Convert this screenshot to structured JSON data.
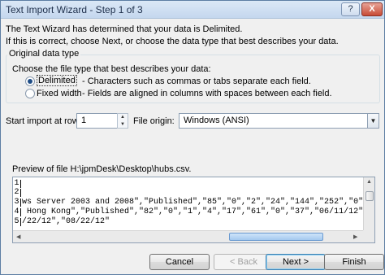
{
  "window": {
    "title": "Text Import Wizard - Step 1 of 3",
    "help_label": "?",
    "close_label": "X"
  },
  "intro": {
    "line1": "The Text Wizard has determined that your data is Delimited.",
    "line2": "If this is correct, choose Next, or choose the data type that best describes your data."
  },
  "original_data_type": {
    "group_label": "Original data type",
    "prompt": "Choose the file type that best describes your data:",
    "options": [
      {
        "label": "Delimited",
        "description": "- Characters such as commas or tabs separate each field.",
        "checked": true
      },
      {
        "label": "Fixed width",
        "description": "- Fields are aligned in columns with spaces between each field.",
        "checked": false
      }
    ]
  },
  "start_row": {
    "label": "Start import at row:",
    "value": "1"
  },
  "file_origin": {
    "label": "File origin:",
    "value": "Windows (ANSI)"
  },
  "preview": {
    "label": "Preview of file H:\\jpmDesk\\Desktop\\hubs.csv.",
    "lines": [
      {
        "num": "1",
        "text": ""
      },
      {
        "num": "2",
        "text": ""
      },
      {
        "num": "3",
        "text": "ws Server 2003 and 2008\",\"Published\",\"85\",\"0\",\"2\",\"24\",\"144\",\"252\",\"0\",\""
      },
      {
        "num": "4",
        "text": " Hong Kong\",\"Published\",\"82\",\"0\",\"1\",\"4\",\"17\",\"61\",\"0\",\"37\",\"06/11/12\",\""
      },
      {
        "num": "5",
        "text": "/22/12\",\"08/22/12\""
      }
    ]
  },
  "buttons": {
    "cancel": "Cancel",
    "back": "< Back",
    "next": "Next >",
    "finish": "Finish"
  },
  "colors": {
    "window_bg": "#f0f0f0",
    "titlebar": "#c4d7ee",
    "close_button": "#c84c36",
    "default_button_border": "#3c7fb1"
  }
}
